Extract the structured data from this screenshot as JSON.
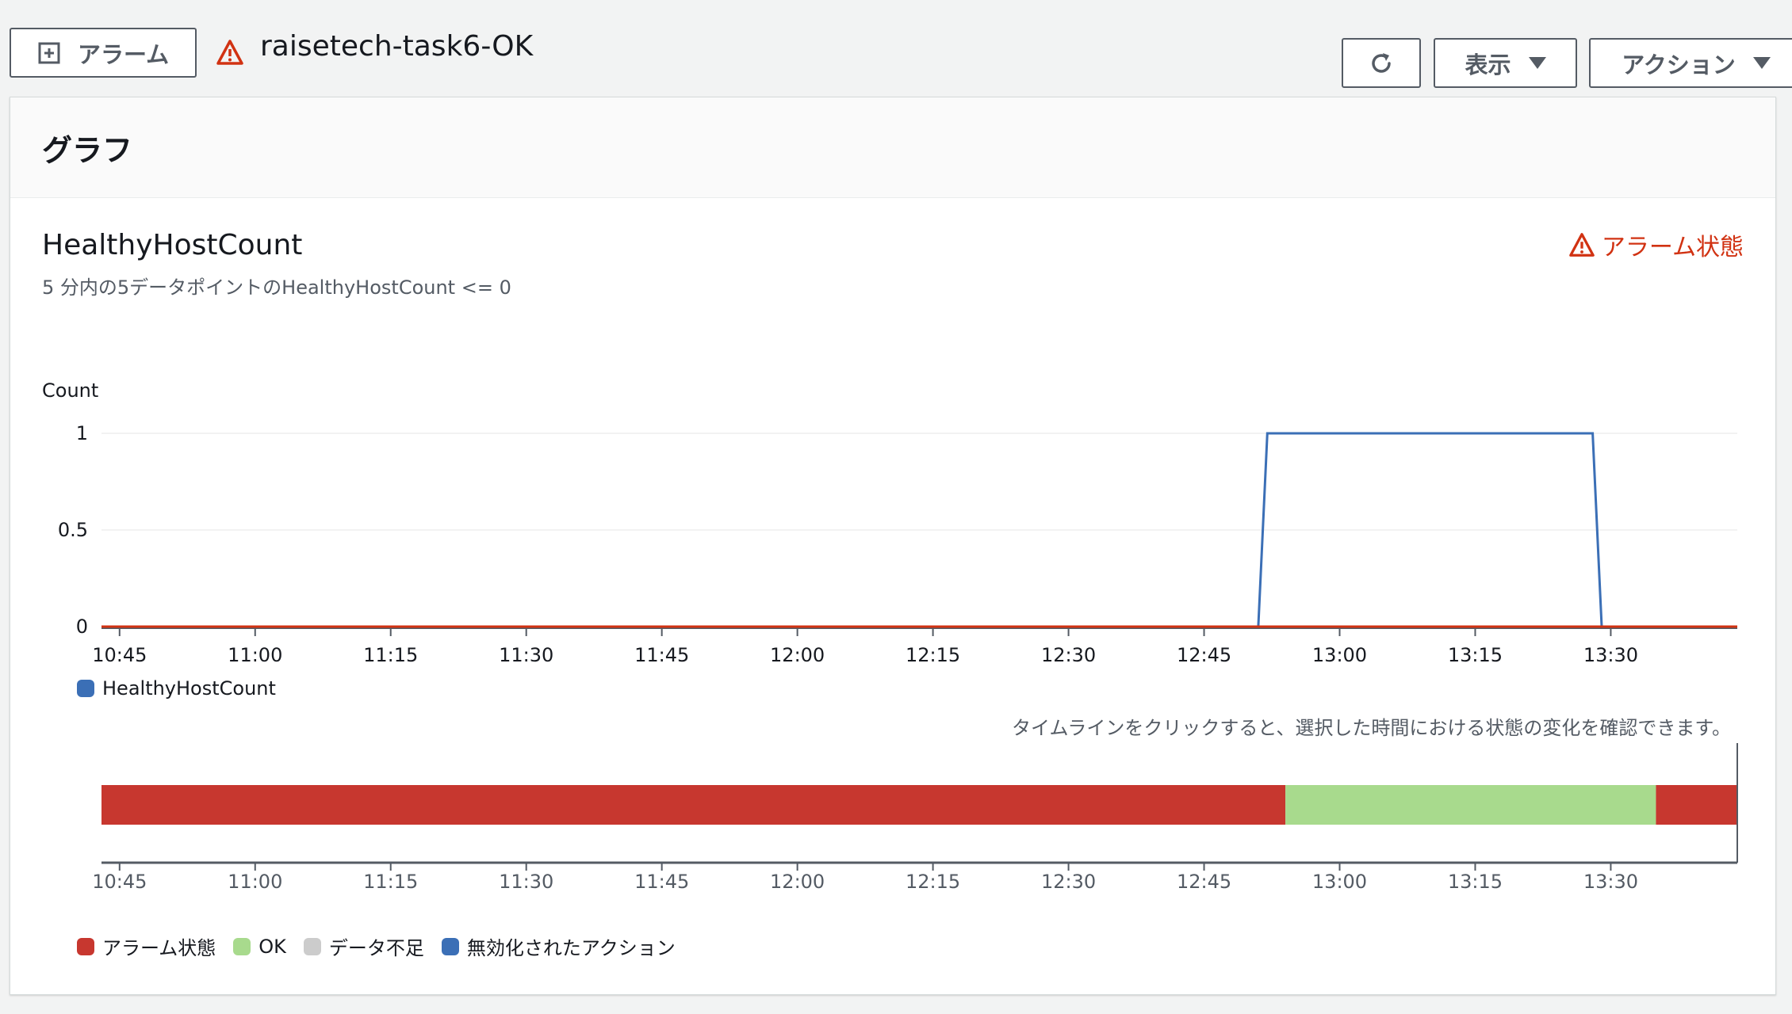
{
  "header": {
    "alarm_button_label": "アラーム",
    "title": "raisetech-task6-OK",
    "view_label": "表示",
    "actions_label": "アクション"
  },
  "panel": {
    "heading": "グラフ",
    "chart_title": "HealthyHostCount",
    "chart_subtitle": "5 分内の5データポイントのHealthyHostCount <= 0",
    "alarm_state_label": "アラーム状態",
    "legend_series": "HealthyHostCount",
    "timeline_hint": "タイムラインをクリックすると、選択した時間における状態の変化を確認できます。",
    "state_legend": [
      {
        "label": "アラーム状態",
        "color": "#c7372f"
      },
      {
        "label": "OK",
        "color": "#a8da8d"
      },
      {
        "label": "データ不足",
        "color": "#cccccc"
      },
      {
        "label": "無効化されたアクション",
        "color": "#3b6fb6"
      }
    ]
  },
  "colors": {
    "alarm": "#d13212",
    "series": "#3b6fb6",
    "threshold": "#d13212",
    "ok": "#a8da8d",
    "alarm_bar": "#c7372f"
  },
  "chart_data": {
    "type": "line",
    "ylabel": "Count",
    "yticks": [
      "0",
      "0.5",
      "1"
    ],
    "ylim": [
      0,
      1
    ],
    "xticks": [
      "10:45",
      "11:00",
      "11:15",
      "11:30",
      "11:45",
      "12:00",
      "12:15",
      "12:30",
      "12:45",
      "13:00",
      "13:15",
      "13:30"
    ],
    "xlim": [
      "10:43",
      "13:44"
    ],
    "series": [
      {
        "name": "HealthyHostCount",
        "points": [
          [
            "10:43",
            0
          ],
          [
            "12:51",
            0
          ],
          [
            "12:52",
            1
          ],
          [
            "13:28",
            1
          ],
          [
            "13:29",
            0
          ],
          [
            "13:44",
            0
          ]
        ]
      }
    ],
    "threshold": 0,
    "grid": true,
    "timeline": {
      "xticks": [
        "10:45",
        "11:00",
        "11:15",
        "11:30",
        "11:45",
        "12:00",
        "12:15",
        "12:30",
        "12:45",
        "13:00",
        "13:15",
        "13:30"
      ],
      "segments": [
        {
          "state": "alarm",
          "from": "10:43",
          "to": "12:54"
        },
        {
          "state": "ok",
          "from": "12:54",
          "to": "13:35"
        },
        {
          "state": "alarm",
          "from": "13:35",
          "to": "13:44"
        }
      ]
    }
  }
}
